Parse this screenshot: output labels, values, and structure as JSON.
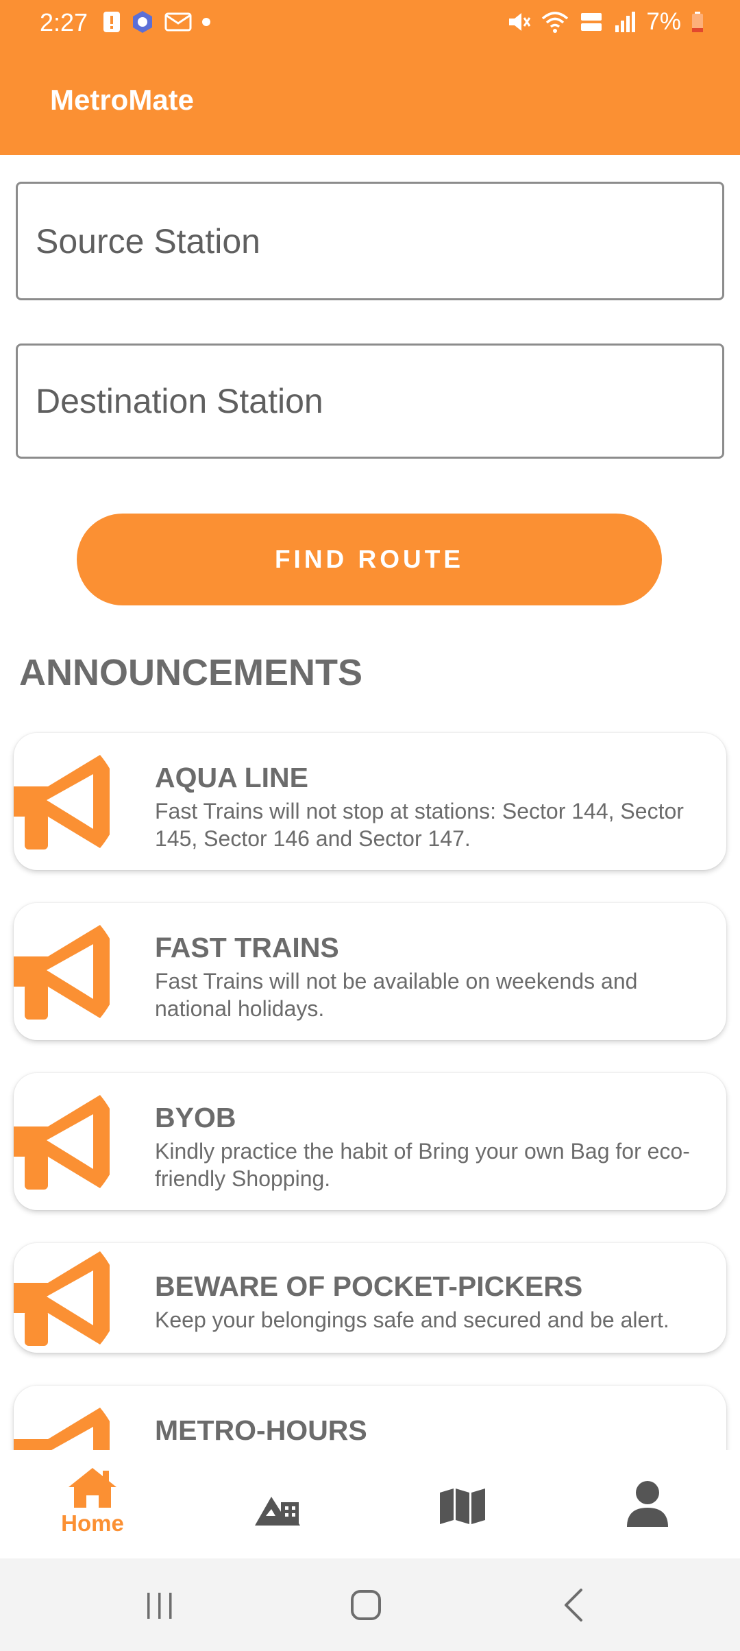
{
  "status_bar": {
    "time": "2:27",
    "battery": "7%"
  },
  "app_bar": {
    "title": "MetroMate"
  },
  "search": {
    "source_placeholder": "Source Station",
    "destination_placeholder": "Destination Station",
    "find_route_label": "FIND ROUTE"
  },
  "announcements": {
    "heading": "ANNOUNCEMENTS",
    "items": [
      {
        "title": "AQUA LINE",
        "text": "Fast Trains will not stop at stations: Sector 144, Sector 145, Sector 146 and Sector 147."
      },
      {
        "title": "FAST TRAINS",
        "text": "Fast Trains will not be available on weekends and national holidays."
      },
      {
        "title": "BYOB",
        "text": "Kindly practice the habit of Bring your own Bag for eco-friendly Shopping."
      },
      {
        "title": "BEWARE OF POCKET-PICKERS",
        "text": "Keep your belongings safe and secured and be alert."
      },
      {
        "title": "METRO-HOURS",
        "text": ""
      }
    ]
  },
  "bottom_nav": {
    "items": [
      {
        "label": "Home",
        "icon": "home-icon",
        "active": true
      },
      {
        "label": "",
        "icon": "city-icon",
        "active": false
      },
      {
        "label": "",
        "icon": "map-icon",
        "active": false
      },
      {
        "label": "",
        "icon": "person-icon",
        "active": false
      }
    ]
  },
  "colors": {
    "accent": "#fb9033",
    "text": "#6b6b6b",
    "inactive_icon": "#555555"
  }
}
